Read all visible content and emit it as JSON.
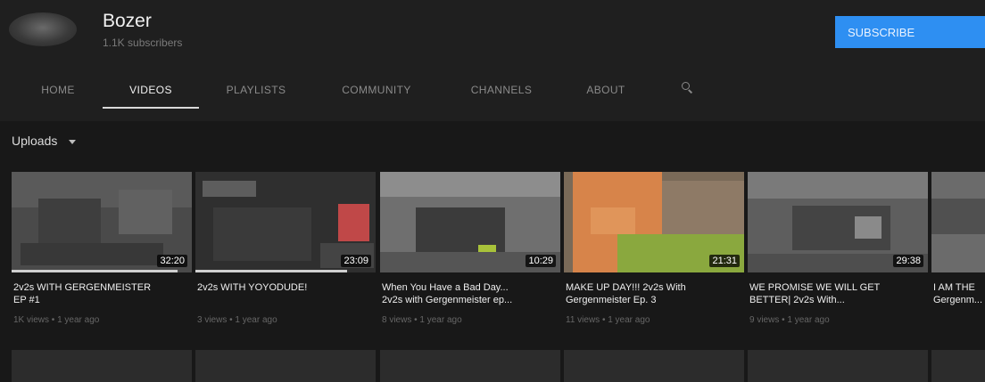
{
  "channel": {
    "name": "Bozer",
    "subscribers": "1.1K subscribers",
    "subscribe_label": "SUBSCRIBE"
  },
  "tabs": [
    "HOME",
    "VIDEOS",
    "PLAYLISTS",
    "COMMUNITY",
    "CHANNELS",
    "ABOUT"
  ],
  "active_tab": "VIDEOS",
  "search_icon": "search-icon",
  "uploads": {
    "label": "Uploads"
  },
  "videos": [
    {
      "title": "2v2s WITH GERGENMEISTER\nEP #1",
      "duration": "32:20",
      "meta": "1K views • 1 year ago",
      "watched": 0.92
    },
    {
      "title": "2v2s WITH YOYODUDE!",
      "duration": "23:09",
      "meta": "3 views • 1 year ago",
      "watched": 0.84
    },
    {
      "title": "When You Have a Bad Day...\n2v2s with Gergenmeister ep...",
      "duration": "10:29",
      "meta": "8 views • 1 year ago",
      "watched": 0
    },
    {
      "title": "MAKE UP DAY!!! 2v2s With\nGergenmeister Ep. 3",
      "duration": "21:31",
      "meta": "11 views • 1 year ago",
      "watched": 0
    },
    {
      "title": "WE PROMISE WE WILL GET\nBETTER| 2v2s With...",
      "duration": "29:38",
      "meta": "9 views • 1 year ago",
      "watched": 0
    },
    {
      "title": "I AM THE\nGergenm...",
      "duration": "",
      "meta": "",
      "watched": 0
    }
  ],
  "colors": {
    "background": "#181818",
    "header": "#1f1f1f",
    "subscribe": "#2e8ff2"
  }
}
